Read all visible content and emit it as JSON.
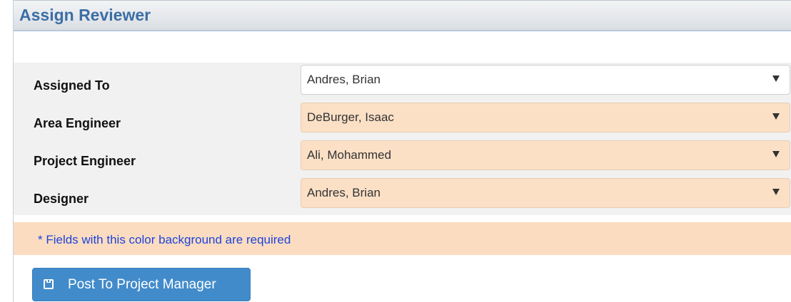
{
  "header": {
    "title": "Assign Reviewer"
  },
  "form": {
    "rows": [
      {
        "label": "Assigned To",
        "value": "Andres, Brian",
        "required": false
      },
      {
        "label": "Area Engineer",
        "value": "DeBurger, Isaac",
        "required": true
      },
      {
        "label": "Project Engineer",
        "value": "Ali, Mohammed",
        "required": true
      },
      {
        "label": "Designer",
        "value": "Andres, Brian",
        "required": true
      }
    ]
  },
  "notice": {
    "text": "* Fields with this color background are required"
  },
  "actions": {
    "post_label": "Post To Project Manager",
    "post_icon": "save-icon"
  },
  "colors": {
    "header_title": "#3b6ea5",
    "required_bg": "#fbe0c6",
    "notice_bg": "#fbdcc1",
    "notice_text": "#1e43d8",
    "button_bg": "#428bca"
  }
}
